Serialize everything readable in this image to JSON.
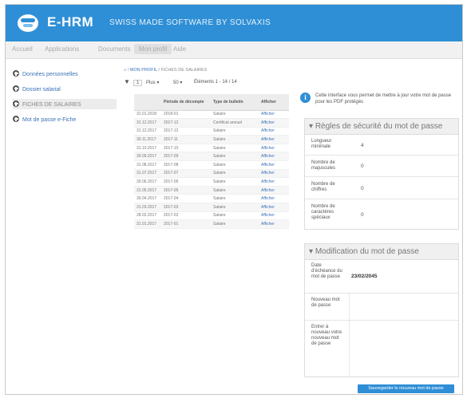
{
  "header": {
    "logo_text": "E-HRM",
    "tagline": "SWISS MADE SOFTWARE BY SOLVAXIS"
  },
  "nav": {
    "items": [
      "Accueil",
      "Applications",
      "Documents",
      "Mon profil",
      "Aide"
    ],
    "active_index": 3
  },
  "sidebar": {
    "items": [
      {
        "label": "Données personnelles"
      },
      {
        "label": "Dossier salarial"
      },
      {
        "label": "FICHES DE SALAIRES"
      },
      {
        "label": "Mot de passe e-Fiche"
      }
    ]
  },
  "breadcrumb": {
    "home": "⌂",
    "sep1": "/",
    "link": "MON PROFIL",
    "sep2": "/",
    "current": "FICHES DE SALAIRES"
  },
  "toolbar": {
    "filter_icon": "filter-icon",
    "page": "1",
    "more_label": "Plus",
    "page_size": "50",
    "items_info": "Éléments 1 - 14 / 14"
  },
  "table": {
    "headers": [
      "",
      "Période de décompte",
      "Type de bulletin",
      "Afficher"
    ],
    "rows": [
      {
        "date": "31.01.2018",
        "period": "2018-01",
        "type": "Salaire",
        "action": "Afficher"
      },
      {
        "date": "31.12.2017",
        "period": "2017-12",
        "type": "Certificat annuel",
        "action": "Afficher"
      },
      {
        "date": "31.12.2017",
        "period": "2017-12",
        "type": "Salaire",
        "action": "Afficher"
      },
      {
        "date": "30.11.2017",
        "period": "2017-11",
        "type": "Salaire",
        "action": "Afficher"
      },
      {
        "date": "31.10.2017",
        "period": "2017-10",
        "type": "Salaire",
        "action": "Afficher"
      },
      {
        "date": "30.09.2017",
        "period": "2017-09",
        "type": "Salaire",
        "action": "Afficher"
      },
      {
        "date": "31.08.2017",
        "period": "2017-08",
        "type": "Salaire",
        "action": "Afficher"
      },
      {
        "date": "31.07.2017",
        "period": "2017-07",
        "type": "Salaire",
        "action": "Afficher"
      },
      {
        "date": "30.06.2017",
        "period": "2017-06",
        "type": "Salaire",
        "action": "Afficher"
      },
      {
        "date": "31.05.2017",
        "period": "2017-05",
        "type": "Salaire",
        "action": "Afficher"
      },
      {
        "date": "30.04.2017",
        "period": "2017-04",
        "type": "Salaire",
        "action": "Afficher"
      },
      {
        "date": "31.03.2017",
        "period": "2017-03",
        "type": "Salaire",
        "action": "Afficher"
      },
      {
        "date": "28.02.2017",
        "period": "2017-02",
        "type": "Salaire",
        "action": "Afficher"
      },
      {
        "date": "31.01.2017",
        "period": "2017-01",
        "type": "Salaire",
        "action": "Afficher"
      }
    ]
  },
  "info": {
    "text": "Cette interface vous permet de mettre à jour votre mot de passe pour les PDF protégés"
  },
  "rules": {
    "title": "Règles de sécurité du mot de passe",
    "rows": [
      {
        "label": "Longueur minimale",
        "value": "4"
      },
      {
        "label": "Nombre de majuscules",
        "value": "0"
      },
      {
        "label": "Nombre de chiffres",
        "value": "0"
      },
      {
        "label": "Nombre de caractères spéciaux",
        "value": "0"
      }
    ]
  },
  "change": {
    "title": "Modification du mot de passe",
    "expiry_label": "Date d'échéance du mot de passe",
    "expiry_value": "23/02/2045",
    "new_label": "Nouveau mot de passe",
    "confirm_label": "Entrer à nouveau votre nouveau mot de passe"
  },
  "save_button": "Sauvegarder le nouveau mot de passe",
  "colors": {
    "brand": "#2f8fd6",
    "link": "#3a73b8"
  }
}
